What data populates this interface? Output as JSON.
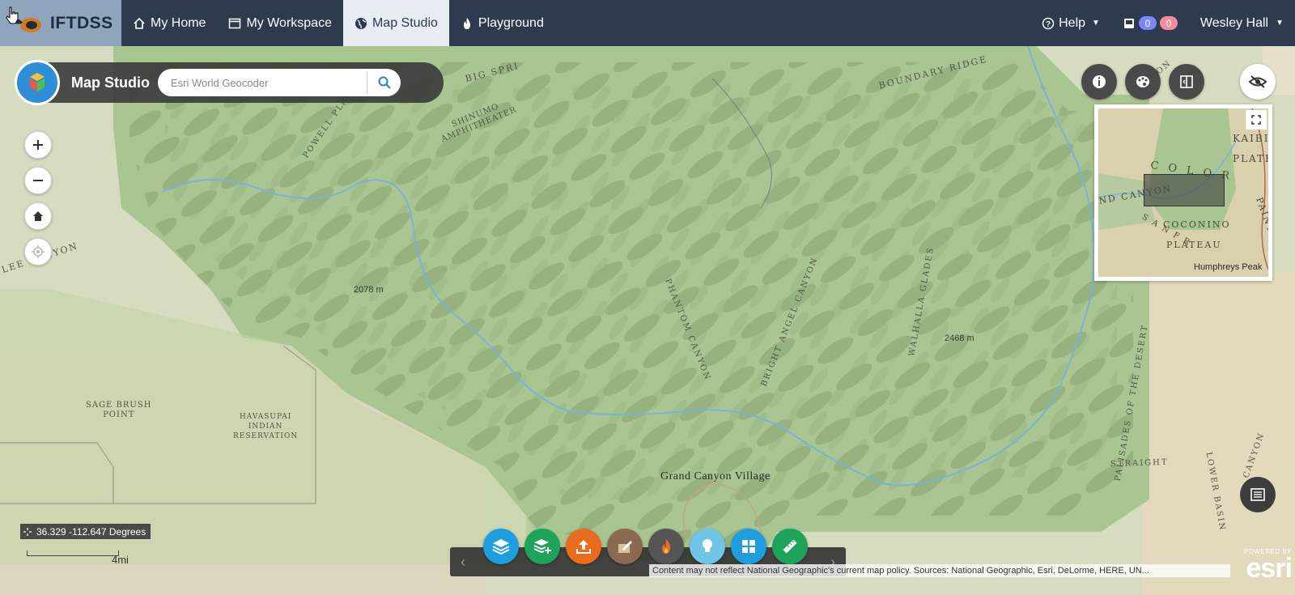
{
  "navbar": {
    "brand": "IFTDSS",
    "items": [
      {
        "label": "My Home",
        "icon": "home-icon"
      },
      {
        "label": "My Workspace",
        "icon": "window-icon"
      },
      {
        "label": "Map Studio",
        "icon": "globe-icon",
        "active": true
      },
      {
        "label": "Playground",
        "icon": "fire-icon"
      }
    ],
    "help_label": "Help",
    "badge_messages": "0",
    "badge_alerts": "0",
    "user_name": "Wesley Hall"
  },
  "studio": {
    "title": "Map Studio",
    "search_placeholder": "Esri World Geocoder"
  },
  "map_labels": {
    "big_spring": "BIG SPRI",
    "boundary_ridge": "BOUNDARY RIDGE",
    "shinumo": "SHINUMO\nAMPHITHEATER",
    "powell": "POWELL PLATEAU",
    "lee_canyon": "LEE CANYON",
    "phantom": "PHANTOM CANYON",
    "bright_angel": "BRIGHT ANGEL CANYON",
    "walhalla": "WALHALLA GLADES",
    "palisades": "PALISADES OF THE DESERT",
    "straight": "STRAIGHT",
    "lower_basin": "LOWER BASIN",
    "sage_brush": "SAGE BRUSH\nPOINT",
    "havasupai": "HAVASUPAI\nINDIAN\nRESERVATION",
    "elev_1": "2078 m",
    "elev_2": "2468 m",
    "village": "Grand Canyon Village",
    "moon": "MOON",
    "canyon": "CANYON"
  },
  "overview": {
    "labels": [
      "C O L O R",
      "PAINTE",
      "KAIBI",
      "PLATE",
      "COCONINO",
      "PLATEAU",
      "ND CANYON",
      "S A N F R"
    ],
    "peak": "Humphreys Peak"
  },
  "coords": {
    "value": "36.329 -112.647 Degrees"
  },
  "scale": {
    "label": "4mi"
  },
  "attribution": "Content may not reflect National Geographic's current map policy. Sources: National Geographic, Esri, DeLorme, HERE, UN...",
  "esri": {
    "powered_by": "POWERED BY",
    "name": "esri"
  },
  "tools": [
    {
      "name": "layers-tool",
      "color": "#1e9ee0"
    },
    {
      "name": "add-layer-tool",
      "color": "#1ea35a"
    },
    {
      "name": "upload-tool",
      "color": "#ea6b1e"
    },
    {
      "name": "edit-tool",
      "color": "#8b6a52"
    },
    {
      "name": "fire-tool",
      "color": "#555555"
    },
    {
      "name": "idea-tool",
      "color": "#6fc5e6"
    },
    {
      "name": "grid-tool",
      "color": "#1e9ee0"
    },
    {
      "name": "measure-tool",
      "color": "#1ea35a"
    }
  ]
}
